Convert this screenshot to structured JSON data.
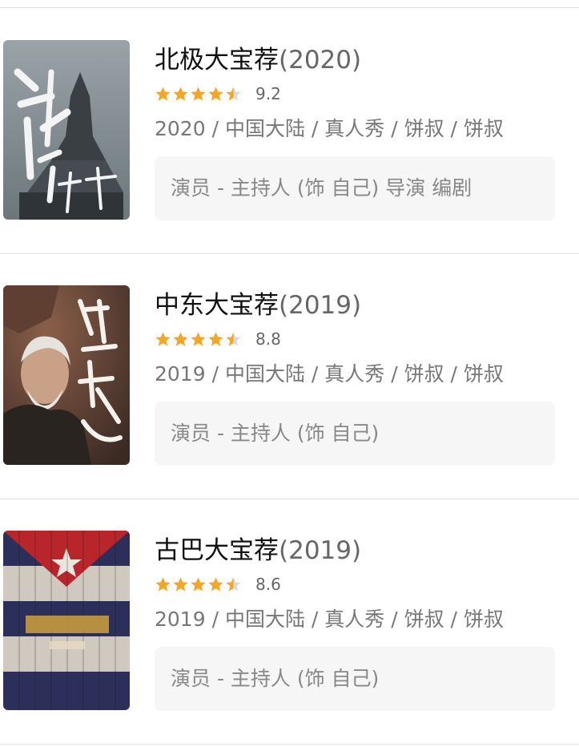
{
  "items": [
    {
      "title": "北极大宝荐",
      "year": "(2020)",
      "rating": 9.2,
      "rating_text": "9.2",
      "stars": 4.5,
      "meta": "2020 / 中国大陆 / 真人秀 / 饼叔 / 饼叔",
      "credits": "演员 - 主持人 (饰 自己) 导演 编剧",
      "poster_icon": "arctic-statue-poster"
    },
    {
      "title": "中东大宝荐",
      "year": "(2019)",
      "rating": 8.8,
      "rating_text": "8.8",
      "stars": 4.5,
      "meta": "2019 / 中国大陆 / 真人秀 / 饼叔 / 饼叔",
      "credits": "演员 - 主持人 (饰 自己)",
      "poster_icon": "middle-east-elder-poster"
    },
    {
      "title": "古巴大宝荐",
      "year": "(2019)",
      "rating": 8.6,
      "rating_text": "8.6",
      "stars": 4.5,
      "meta": "2019 / 中国大陆 / 真人秀 / 饼叔 / 饼叔",
      "credits": "演员 - 主持人 (饰 自己)",
      "poster_icon": "cuba-flag-poster"
    }
  ],
  "colors": {
    "star_filled": "#f5a623",
    "star_empty": "#d9d9d9",
    "divider": "#e3e3e3",
    "credits_bg": "#f6f6f6"
  }
}
